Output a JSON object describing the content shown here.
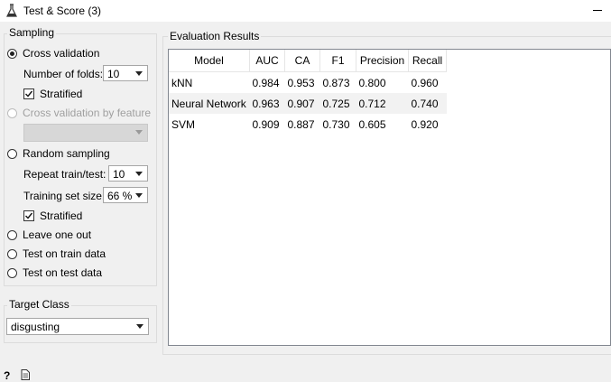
{
  "window": {
    "title": "Test & Score (3)"
  },
  "sampling": {
    "title": "Sampling",
    "cross_validation": "Cross validation",
    "folds_label": "Number of folds:",
    "folds_value": "10",
    "stratified_1": "Stratified",
    "cv_by_feature": "Cross validation by feature",
    "random_sampling": "Random sampling",
    "repeat_label": "Repeat train/test:",
    "repeat_value": "10",
    "training_size_label": "Training set size:",
    "training_size_value": "66 %",
    "stratified_2": "Stratified",
    "leave_one_out": "Leave one out",
    "test_on_train": "Test on train data",
    "test_on_test": "Test on test data"
  },
  "target": {
    "title": "Target Class",
    "value": "disgusting"
  },
  "results": {
    "title": "Evaluation Results",
    "columns": [
      "Model",
      "AUC",
      "CA",
      "F1",
      "Precision",
      "Recall"
    ],
    "rows": [
      [
        "kNN",
        "0.984",
        "0.953",
        "0.873",
        "0.800",
        "0.960"
      ],
      [
        "Neural Network",
        "0.963",
        "0.907",
        "0.725",
        "0.712",
        "0.740"
      ],
      [
        "SVM",
        "0.909",
        "0.887",
        "0.730",
        "0.605",
        "0.920"
      ]
    ]
  },
  "status": {
    "help_glyph": "?"
  },
  "icons": [
    "flask-icon",
    "help-icon",
    "report-icon",
    "minimize-icon"
  ]
}
